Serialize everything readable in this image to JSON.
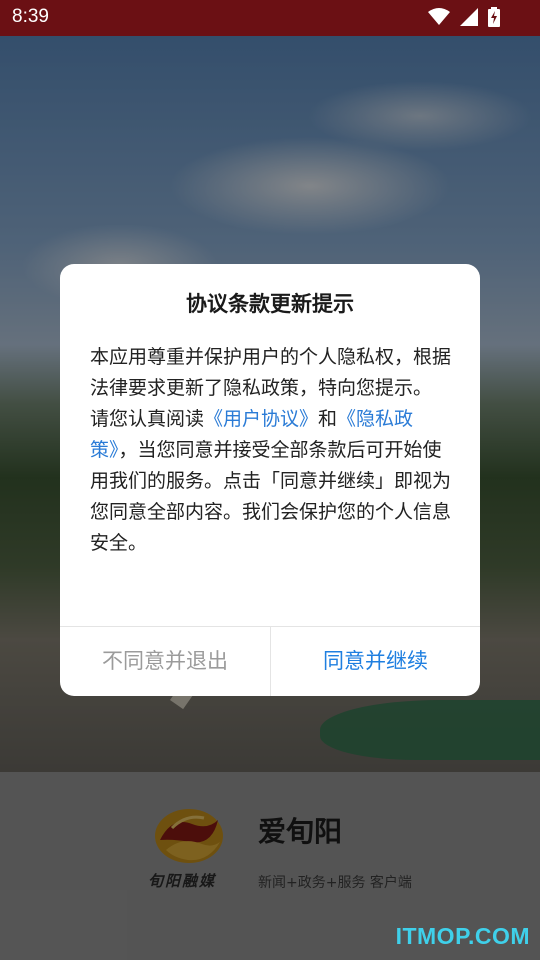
{
  "status_bar": {
    "time": "8:39",
    "icons": [
      "wifi-icon",
      "signal-icon",
      "battery-charging-icon"
    ]
  },
  "dialog": {
    "title": "协议条款更新提示",
    "paragraph1": "本应用尊重并保护用户的个人隐私权，根据法律要求更新了隐私政策，特向您提示。",
    "paragraph2_prefix": "请您认真阅读",
    "user_agreement_link": "《用户协议》",
    "and_text": "和",
    "privacy_policy_link": "《隐私政策》",
    "paragraph2_suffix": "，当您同意并接受全部条款后可开始使用我们的服务。点击「同意并继续」即视为您同意全部内容。我们会保护您的个人信息安全。",
    "decline_button": "不同意并退出",
    "accept_button": "同意并继续"
  },
  "brand": {
    "logo_text": "旬阳融媒",
    "name": "爱旬阳",
    "tagline": "新闻+政务+服务 客户端"
  },
  "watermark": "ITMOP.COM",
  "colors": {
    "status_bar": "#6b1014",
    "link": "#2a7bd6",
    "accept": "#1f7fe0",
    "decline": "#9b9b9b",
    "watermark": "#3fd0ea"
  }
}
